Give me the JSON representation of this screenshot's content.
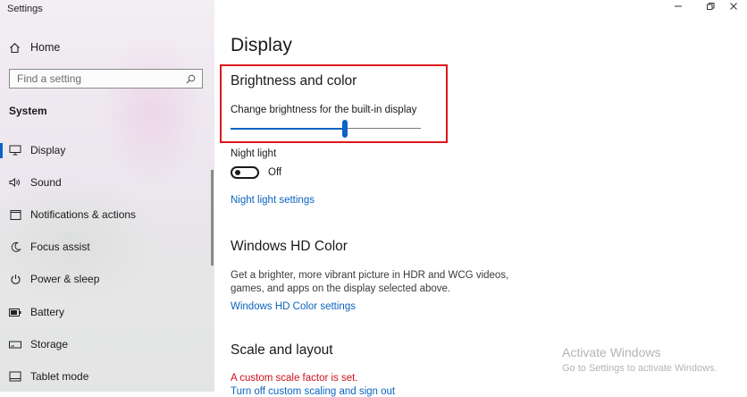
{
  "window": {
    "title": "Settings"
  },
  "sidebar": {
    "home_label": "Home",
    "search_placeholder": "Find a setting",
    "section_label": "System",
    "items": [
      {
        "label": "Display",
        "icon": "monitor-icon",
        "active": true
      },
      {
        "label": "Sound",
        "icon": "speaker-icon"
      },
      {
        "label": "Notifications & actions",
        "icon": "notification-icon"
      },
      {
        "label": "Focus assist",
        "icon": "moon-icon"
      },
      {
        "label": "Power & sleep",
        "icon": "power-icon"
      },
      {
        "label": "Battery",
        "icon": "battery-icon"
      },
      {
        "label": "Storage",
        "icon": "storage-icon"
      },
      {
        "label": "Tablet mode",
        "icon": "tablet-icon"
      }
    ]
  },
  "main": {
    "title": "Display",
    "brightness": {
      "heading": "Brightness and color",
      "slider_label": "Change brightness for the built-in display",
      "value_percent": 60
    },
    "night_light": {
      "label": "Night light",
      "state": "Off",
      "settings_link": "Night light settings"
    },
    "hd_color": {
      "heading": "Windows HD Color",
      "description_line1": "Get a brighter, more vibrant picture in HDR and WCG videos,",
      "description_line2": "games, and apps on the display selected above.",
      "settings_link": "Windows HD Color settings"
    },
    "scale": {
      "heading": "Scale and layout",
      "warning": "A custom scale factor is set.",
      "link_partial": "Turn off custom scaling and sign out"
    }
  },
  "watermark": {
    "line1": "Activate Windows",
    "line2": "Go to Settings to activate Windows."
  },
  "colors": {
    "accent": "#0b63c1",
    "highlight_border": "#e0161c",
    "warning": "#d0101a"
  }
}
